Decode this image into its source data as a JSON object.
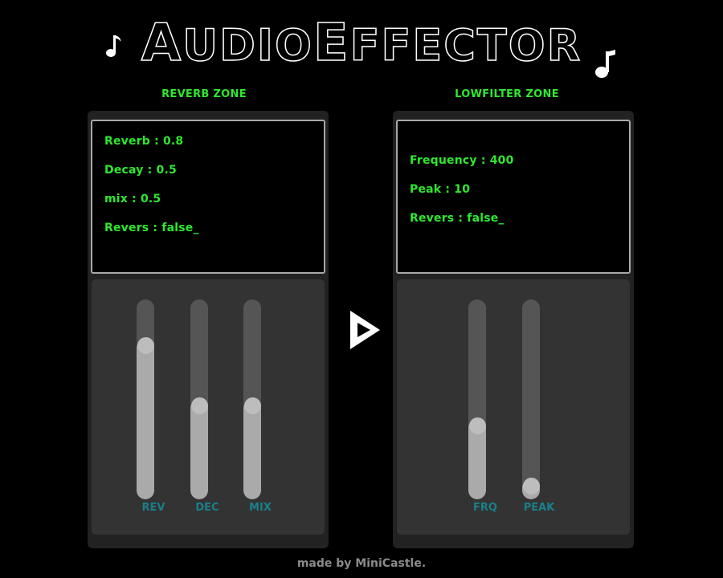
{
  "app": {
    "title_first_letter": "A",
    "title_rest_1": "UDIO",
    "title_second_letter": "E",
    "title_rest_2": "FFECTOR"
  },
  "reverb_zone": {
    "label": "REVERB ZONE",
    "lines": [
      "Reverb : 0.8",
      "Decay : 0.5",
      "mix : 0.5",
      "Revers : false_"
    ],
    "sliders": [
      {
        "label": "REV",
        "level": 0.8
      },
      {
        "label": "DEC",
        "level": 0.5
      },
      {
        "label": "MIX",
        "level": 0.5
      }
    ]
  },
  "lowfilter_zone": {
    "label": "LOWFILTER ZONE",
    "lines": [
      "Frequency : 400",
      "Peak : 10",
      "Revers : false_"
    ],
    "sliders": [
      {
        "label": "FRQ",
        "level": 0.4
      },
      {
        "label": "PEAK",
        "level": 0.1
      }
    ]
  },
  "footer": "made by MiniCastle.",
  "colors": {
    "accent_green": "#2ee82e",
    "slider_label": "#1a7f8a",
    "background": "#000000"
  },
  "icons": {
    "note_left": "eighth-note-icon",
    "note_right": "eighth-note-icon",
    "play": "play-icon"
  }
}
